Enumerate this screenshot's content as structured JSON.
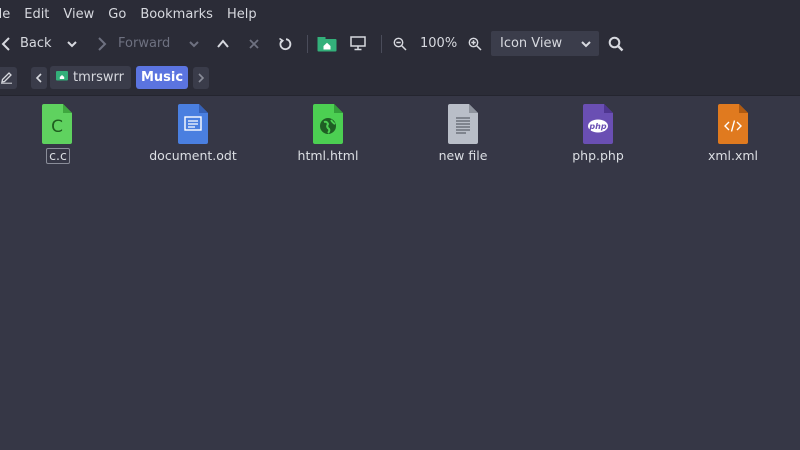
{
  "menu": [
    "File",
    "Edit",
    "View",
    "Go",
    "Bookmarks",
    "Help"
  ],
  "menu_visible": [
    "ile",
    "Edit",
    "View",
    "Go",
    "Bookmarks",
    "Help"
  ],
  "toolbar": {
    "back_label": "Back",
    "forward_label": "Forward",
    "zoom_level": "100%",
    "view_mode": "Icon View"
  },
  "pathbar": {
    "home_label": "tmrswrr",
    "current_label": "Music"
  },
  "files": [
    {
      "name": "c.c",
      "icon": "c-source-icon",
      "color": "#5fd25f"
    },
    {
      "name": "document.odt",
      "icon": "document-icon",
      "color": "#4a7fe0"
    },
    {
      "name": "html.html",
      "icon": "html-globe-icon",
      "color": "#4ccf52"
    },
    {
      "name": "new file",
      "icon": "text-file-icon",
      "color": "#b9bec8"
    },
    {
      "name": "php.php",
      "icon": "php-icon",
      "color": "#6a4fb3"
    },
    {
      "name": "xml.xml",
      "icon": "xml-code-icon",
      "color": "#e07a1f"
    }
  ],
  "colors": {
    "background": "#363746",
    "toolbar": "#2b2c37",
    "accent": "#5b74e0",
    "home_folder": "#33b07a"
  }
}
